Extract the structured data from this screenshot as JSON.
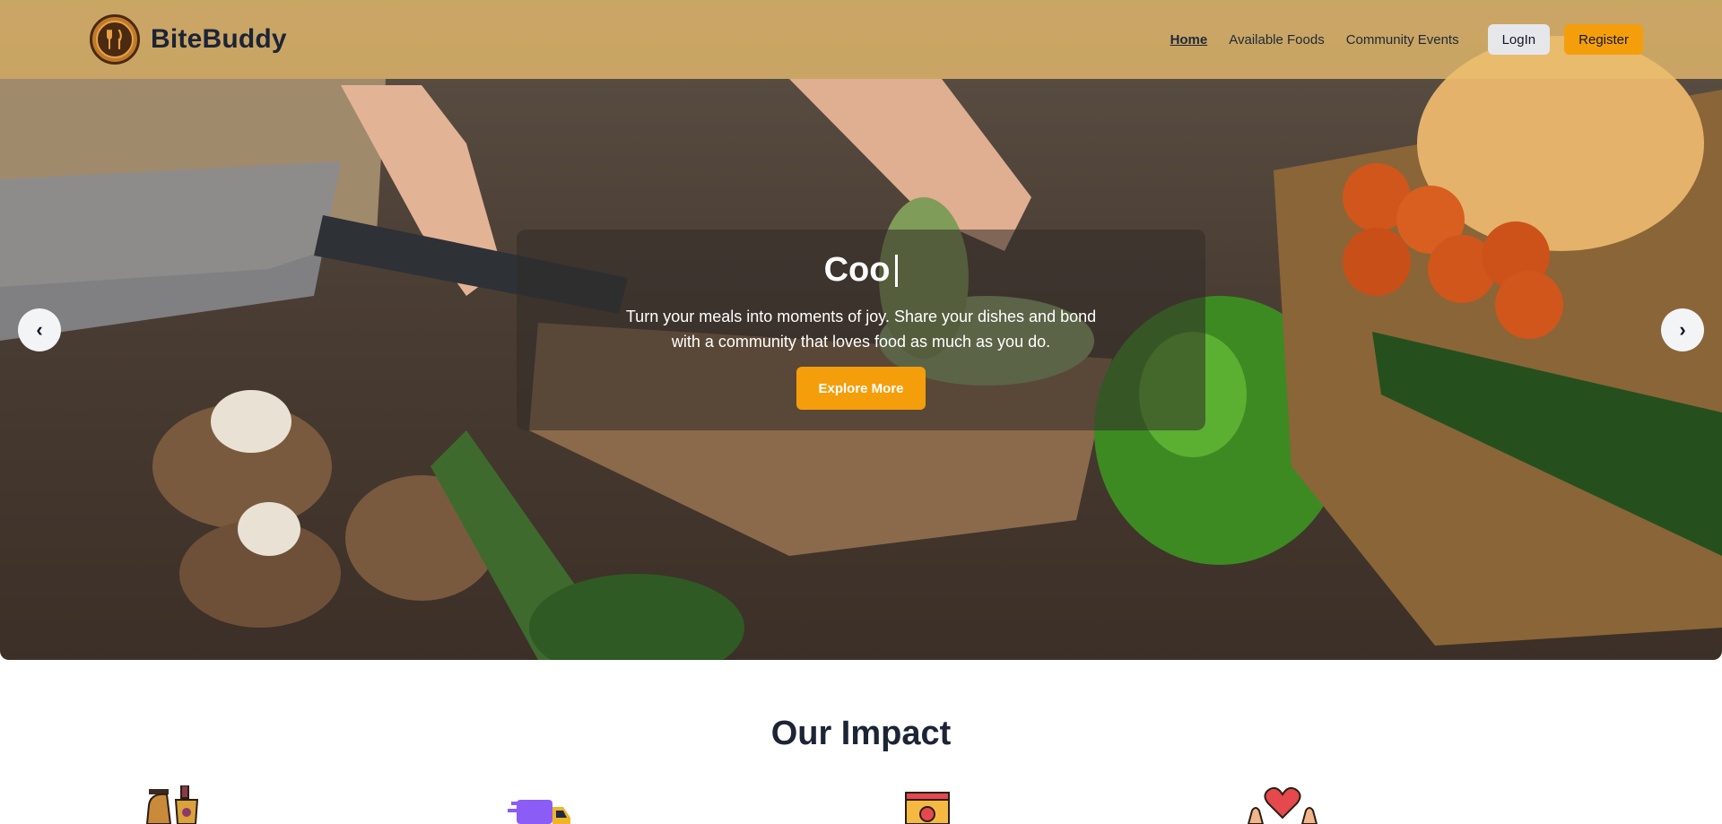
{
  "brand": {
    "name": "BiteBuddy"
  },
  "nav": {
    "links": [
      {
        "label": "Home",
        "active": true
      },
      {
        "label": "Available Foods",
        "active": false
      },
      {
        "label": "Community Events",
        "active": false
      }
    ],
    "login_label": "LogIn",
    "register_label": "Register"
  },
  "hero": {
    "title_typed": "Coo",
    "subtitle": "Turn your meals into moments of joy. Share your dishes and bond with a community that loves food as much as you do.",
    "cta_label": "Explore More",
    "prev_symbol": "‹",
    "next_symbol": "›"
  },
  "impact": {
    "title": "Our Impact",
    "icons": [
      "food-basket-icon",
      "delivery-truck-icon",
      "food-jar-icon",
      "heart-hands-icon"
    ]
  },
  "colors": {
    "navbar": "#e9be6e",
    "accent": "#f59e0b",
    "heading": "#1c2436"
  }
}
